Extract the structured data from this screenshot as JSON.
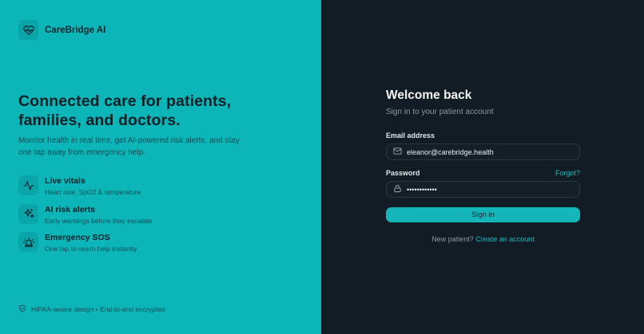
{
  "brand": {
    "name": "CareBridge AI",
    "icon": "heart-pulse-icon"
  },
  "hero": {
    "title": "Connected care for patients, families, and doctors.",
    "subtitle": "Monitor health in real time, get AI-powered risk alerts, and stay one tap away from emergency help."
  },
  "features": [
    {
      "title": "Live vitals",
      "desc": "Heart rate, SpO2 & temperature",
      "icon": "activity-icon"
    },
    {
      "title": "AI risk alerts",
      "desc": "Early warnings before they escalate",
      "icon": "sparkles-icon"
    },
    {
      "title": "Emergency SOS",
      "desc": "One tap to reach help instantly",
      "icon": "siren-icon"
    }
  ],
  "footer": {
    "note": "HIPAA-aware design • End-to-end encrypted",
    "icon": "shield-check-icon"
  },
  "login": {
    "title": "Welcome back",
    "subtitle": "Sign in to your patient account",
    "email_label": "Email address",
    "email_value": "eleanor@carebridge.health",
    "password_label": "Password",
    "forgot_label": "Forgot?",
    "password_value": "••••••••••••",
    "signin_label": "Sign in",
    "new_patient_text": "New patient?",
    "create_account_label": "Create an account"
  },
  "colors": {
    "left_bg": "#0bb5b8",
    "right_bg": "#121c24",
    "accent": "#15b6ba"
  }
}
